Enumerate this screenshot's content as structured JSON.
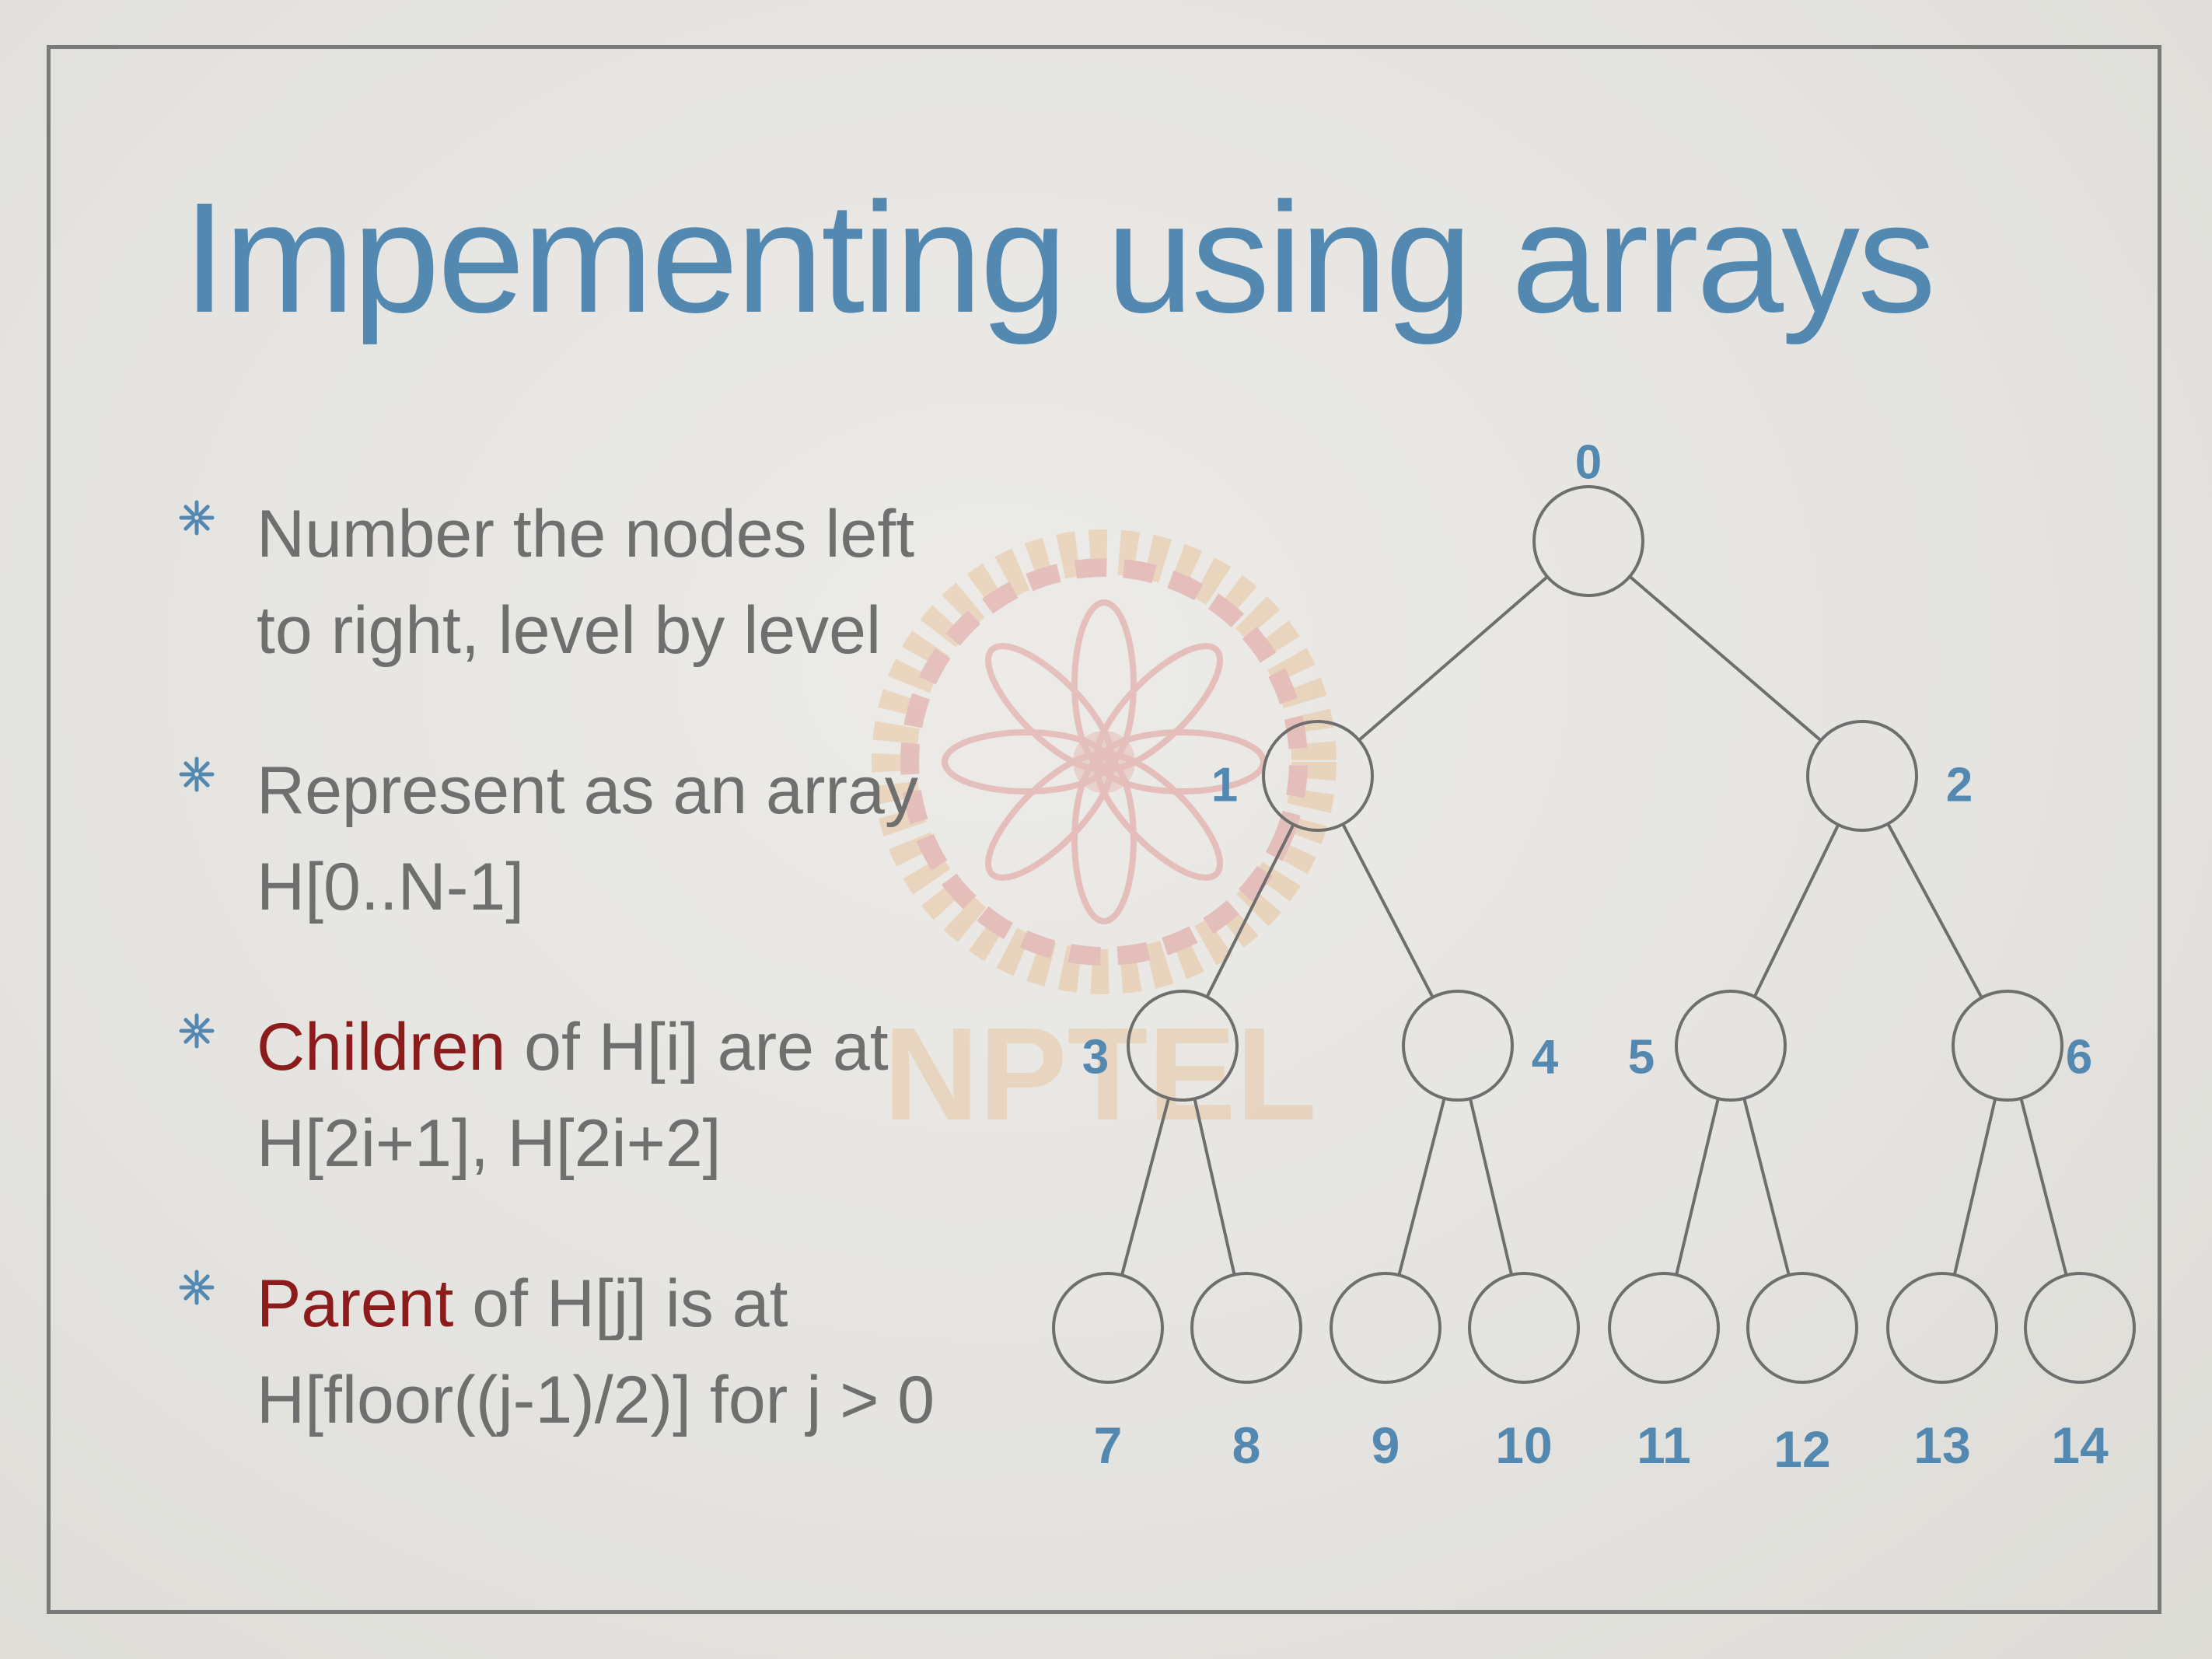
{
  "slide": {
    "title": "Impementing using arrays",
    "bullets": [
      {
        "lines": [
          {
            "parts": [
              {
                "text": "Number the nodes left",
                "highlight": false
              }
            ]
          },
          {
            "parts": [
              {
                "text": "to right, level by level",
                "highlight": false
              }
            ]
          }
        ]
      },
      {
        "lines": [
          {
            "parts": [
              {
                "text": "Represent as an array",
                "highlight": false
              }
            ]
          },
          {
            "parts": [
              {
                "text": "H[0..N-1]",
                "highlight": false
              }
            ]
          }
        ]
      },
      {
        "lines": [
          {
            "parts": [
              {
                "text": "Children",
                "highlight": true
              },
              {
                "text": " of H[i] are at",
                "highlight": false
              }
            ]
          },
          {
            "parts": [
              {
                "text": "H[2i+1], H[2i+2]",
                "highlight": false
              }
            ]
          }
        ]
      },
      {
        "lines": [
          {
            "parts": [
              {
                "text": "Parent",
                "highlight": true
              },
              {
                "text": " of H[j] is at",
                "highlight": false
              }
            ]
          },
          {
            "parts": [
              {
                "text": "H[floor((j-1)/2)] for j > 0",
                "highlight": false
              }
            ]
          }
        ]
      }
    ],
    "tree_nodes": [
      "0",
      "1",
      "2",
      "3",
      "4",
      "5",
      "6",
      "7",
      "8",
      "9",
      "10",
      "11",
      "12",
      "13",
      "14"
    ],
    "watermark_text": "NPTEL",
    "colors": {
      "title": "#5389b1",
      "text": "#6f6f6f",
      "highlight": "#8c1c1c",
      "node_label": "#5389b1",
      "node_stroke": "#6e6e6e",
      "frame": "#7a7a7a"
    }
  }
}
